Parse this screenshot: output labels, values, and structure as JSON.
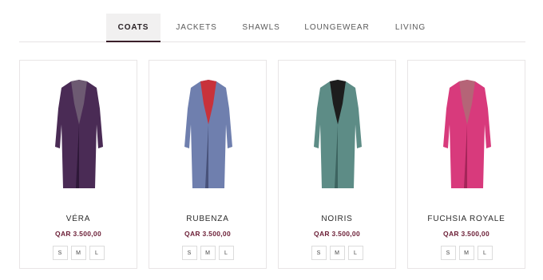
{
  "tabs": [
    {
      "label": "COATS"
    },
    {
      "label": "JACKETS"
    },
    {
      "label": "SHAWLS"
    },
    {
      "label": "LOUNGEWEAR"
    },
    {
      "label": "LIVING"
    }
  ],
  "products": [
    {
      "name": "VÉRA",
      "price": "QAR 3.500,00",
      "sizes": [
        "S",
        "M",
        "L"
      ],
      "color": "#4a2b55",
      "lapel": "#6d5a72",
      "shadow": "#2e1838"
    },
    {
      "name": "RUBENZA",
      "price": "QAR 3.500,00",
      "sizes": [
        "S",
        "M",
        "L"
      ],
      "color": "#6f7fae",
      "lapel": "#c8323a",
      "shadow": "#48527a"
    },
    {
      "name": "NOIRIS",
      "price": "QAR 3.500,00",
      "sizes": [
        "S",
        "M",
        "L"
      ],
      "color": "#5d8c86",
      "lapel": "#1d1d1d",
      "shadow": "#3d6460"
    },
    {
      "name": "FUCHSIA ROYALE",
      "price": "QAR 3.500,00",
      "sizes": [
        "S",
        "M",
        "L"
      ],
      "color": "#d83a7c",
      "lapel": "#b56477",
      "shadow": "#a42559"
    }
  ]
}
